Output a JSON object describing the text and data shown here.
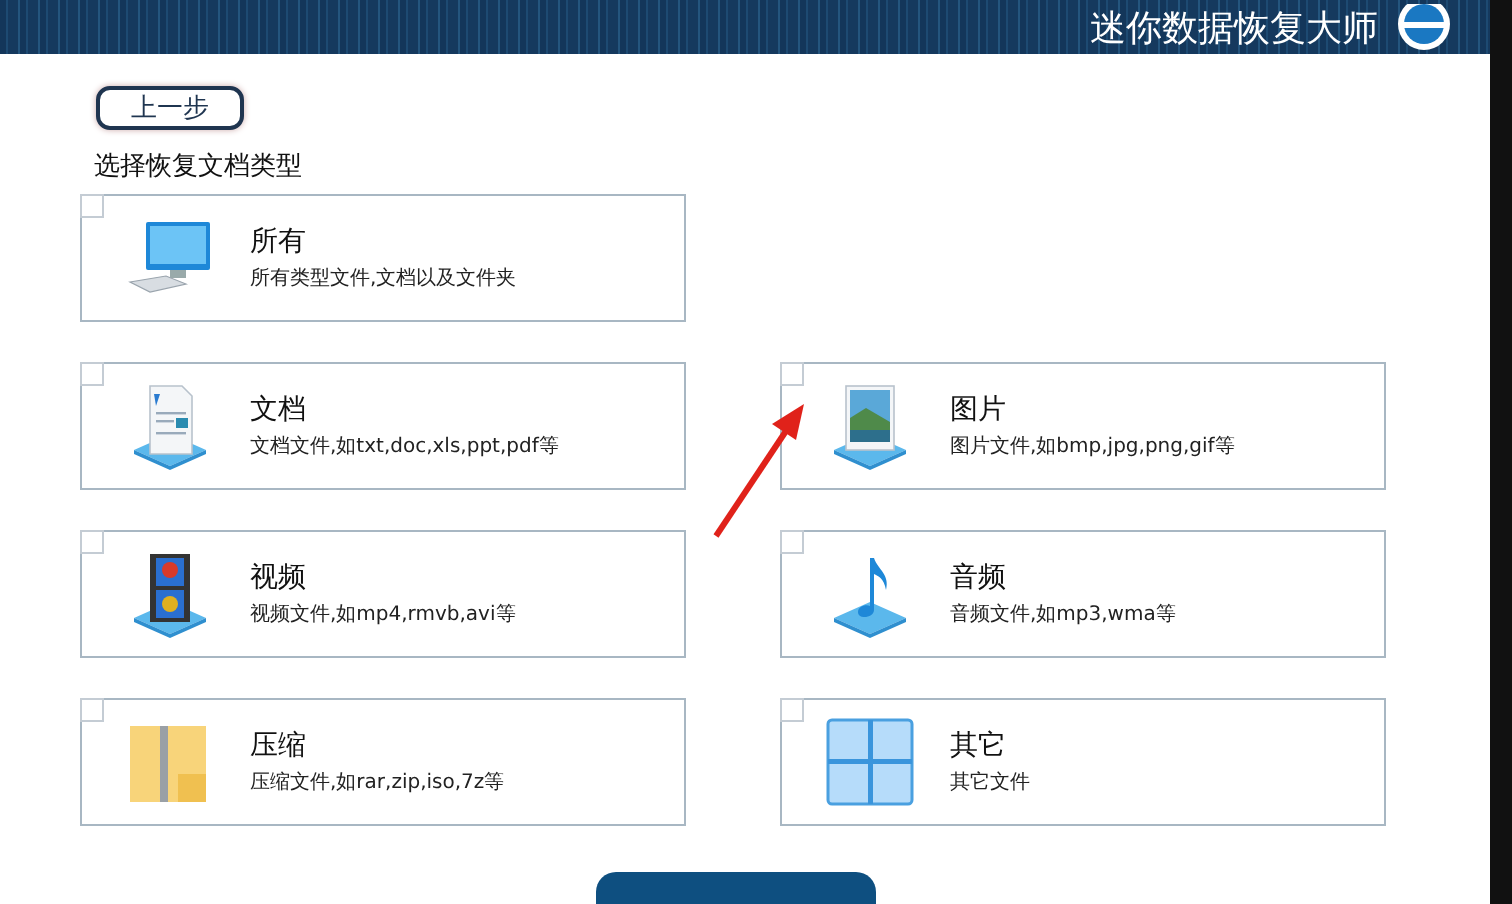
{
  "header": {
    "title": "迷你数据恢复大师"
  },
  "back_button": {
    "label": "上一步"
  },
  "section_label": "选择恢复文档类型",
  "rows": [
    [
      {
        "kind": "computer",
        "title": "所有",
        "description": "所有类型文件,文档以及文件夹",
        "checked": false
      }
    ],
    [
      {
        "kind": "document",
        "title": "文档",
        "description": "文档文件,如txt,doc,xls,ppt,pdf等",
        "checked": false
      },
      {
        "kind": "picture",
        "title": "图片",
        "description": "图片文件,如bmp,jpg,png,gif等",
        "checked": false
      }
    ],
    [
      {
        "kind": "video",
        "title": "视频",
        "description": "视频文件,如mp4,rmvb,avi等",
        "checked": false
      },
      {
        "kind": "audio",
        "title": "音频",
        "description": "音频文件,如mp3,wma等",
        "checked": false
      }
    ],
    [
      {
        "kind": "archive",
        "title": "压缩",
        "description": "压缩文件,如rar,zip,iso,7z等",
        "checked": false
      },
      {
        "kind": "other",
        "title": "其它",
        "description": "其它文件",
        "checked": false
      }
    ]
  ]
}
